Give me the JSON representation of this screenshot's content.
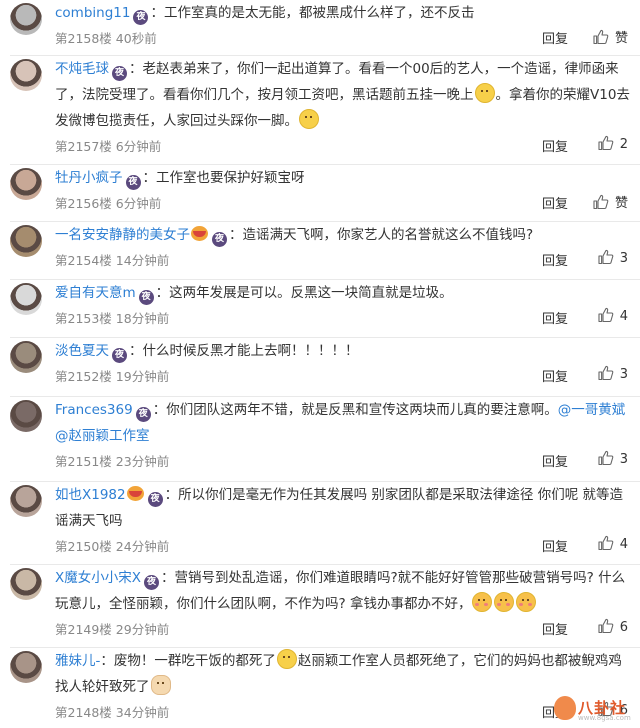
{
  "reply_label": "回复",
  "comments": [
    {
      "username": "combing11",
      "night": "夜",
      "badge": false,
      "parts": [
        {
          "t": "text",
          "v": "工作室真的是太无能，都被黑成什么样了，还不反击"
        }
      ],
      "floor": "第2158楼",
      "time": "40秒前",
      "likes": "赞"
    },
    {
      "username": "不炖毛球",
      "night": "夜",
      "badge": false,
      "parts": [
        {
          "t": "text",
          "v": "老赵表弟来了，你们一起出道算了。看看一个00后的艺人，一个造谣，律师函来了，法院受理了。看看你们几个，按月领工资吧，黑话题前五挂一晚上"
        },
        {
          "t": "emoji",
          "v": "smile"
        },
        {
          "t": "text",
          "v": "。拿着你的荣耀V10去发微博包揽责任，人家回过头踩你一脚。"
        },
        {
          "t": "emoji",
          "v": "smile"
        }
      ],
      "floor": "第2157楼",
      "time": "6分钟前",
      "likes": "2"
    },
    {
      "username": "牡丹小疯子",
      "night": "夜",
      "badge": false,
      "parts": [
        {
          "t": "text",
          "v": "工作室也要保护好颖宝呀"
        }
      ],
      "floor": "第2156楼",
      "time": "6分钟前",
      "likes": "赞"
    },
    {
      "username": "一名安安静静的美女子",
      "night": "夜",
      "badge": true,
      "parts": [
        {
          "t": "text",
          "v": "造谣满天飞啊，你家艺人的名誉就这么不值钱吗?"
        }
      ],
      "floor": "第2154楼",
      "time": "14分钟前",
      "likes": "3"
    },
    {
      "username": "爱自有天意m",
      "night": "夜",
      "badge": false,
      "parts": [
        {
          "t": "text",
          "v": "这两年发展是可以。反黑这一块简直就是垃圾。"
        }
      ],
      "floor": "第2153楼",
      "time": "18分钟前",
      "likes": "4"
    },
    {
      "username": "淡色夏天",
      "night": "夜",
      "badge": false,
      "parts": [
        {
          "t": "text",
          "v": "什么时候反黑才能上去啊！！！！！"
        }
      ],
      "floor": "第2152楼",
      "time": "19分钟前",
      "likes": "3"
    },
    {
      "username": "Frances369",
      "night": "夜",
      "badge": false,
      "parts": [
        {
          "t": "text",
          "v": "你们团队这两年不错，就是反黑和宣传这两块而儿真的要注意啊。"
        },
        {
          "t": "mention",
          "v": "@一哥黄斌"
        },
        {
          "t": "text",
          "v": " "
        },
        {
          "t": "mention",
          "v": "@赵丽颖工作室"
        }
      ],
      "floor": "第2151楼",
      "time": "23分钟前",
      "likes": "3"
    },
    {
      "username": "如也X1982",
      "night": "夜",
      "badge": true,
      "parts": [
        {
          "t": "text",
          "v": "所以你们是毫无作为任其发展吗 别家团队都是采取法律途径 你们呢 就等造谣满天飞吗"
        }
      ],
      "floor": "第2150楼",
      "time": "24分钟前",
      "likes": "4"
    },
    {
      "username": "X魔女小小宋X",
      "night": "夜",
      "badge": false,
      "parts": [
        {
          "t": "text",
          "v": "营销号到处乱造谣，你们难道眼睛吗?就不能好好管管那些破营销号吗? 什么玩意儿，全怪丽颖，你们什么团队啊，不作为吗? 拿钱办事都办不好，"
        },
        {
          "t": "emoji",
          "v": "blush"
        },
        {
          "t": "emoji",
          "v": "blush"
        },
        {
          "t": "emoji",
          "v": "blush"
        }
      ],
      "floor": "第2149楼",
      "time": "29分钟前",
      "likes": "6"
    },
    {
      "username": "雅妹儿-",
      "night": "",
      "badge": false,
      "parts": [
        {
          "t": "text",
          "v": "废物！一群吃干饭的都死了"
        },
        {
          "t": "emoji",
          "v": "smile"
        },
        {
          "t": "text",
          "v": "赵丽颖工作室人员都死绝了，它们的妈妈也都被鲵鸡鸡找人轮奸致死了"
        },
        {
          "t": "emoji",
          "v": "ok"
        }
      ],
      "floor": "第2148楼",
      "time": "34分钟前",
      "likes": "6"
    }
  ],
  "watermark": {
    "title": "八卦社",
    "sub": "www.8gsa.com"
  },
  "colors": {
    "username": "#2e7fd3",
    "meta": "#888888",
    "night_badge": "#5b4a7e"
  }
}
